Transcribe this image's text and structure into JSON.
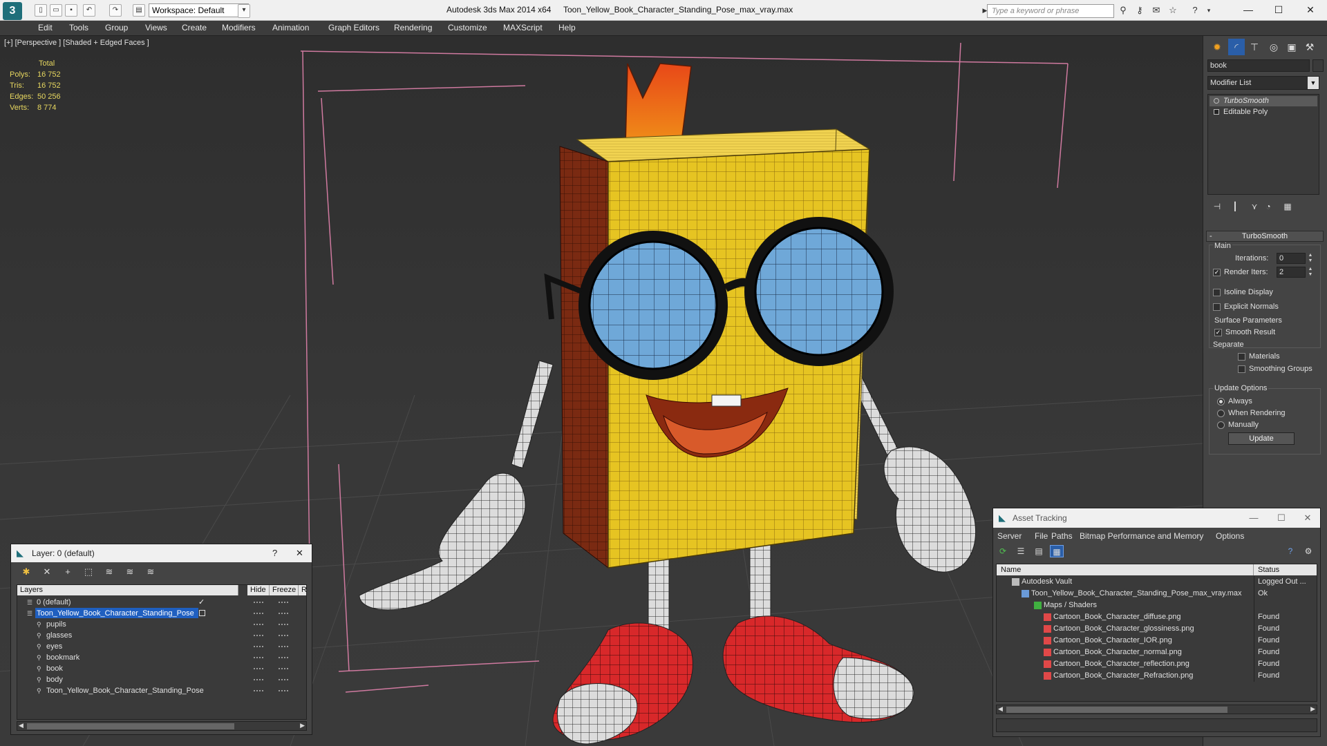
{
  "titlebar": {
    "workspace": "Workspace: Default",
    "app": "Autodesk 3ds Max  2014 x64",
    "file": "Toon_Yellow_Book_Character_Standing_Pose_max_vray.max",
    "search_placeholder": "Type a keyword or phrase"
  },
  "menu": [
    "Edit",
    "Tools",
    "Group",
    "Views",
    "Create",
    "Modifiers",
    "Animation",
    "Graph Editors",
    "Rendering",
    "Customize",
    "MAXScript",
    "Help"
  ],
  "viewport": {
    "label": "[+] [Perspective ] [Shaded + Edged Faces ]",
    "stats": {
      "header": "Total",
      "rows": [
        {
          "label": "Polys:",
          "value": "16 752"
        },
        {
          "label": "Tris:",
          "value": "16 752"
        },
        {
          "label": "Edges:",
          "value": "50 256"
        },
        {
          "label": "Verts:",
          "value": "8 774"
        }
      ]
    }
  },
  "command_panel": {
    "object_name": "book",
    "modifier_list": "Modifier List",
    "stack": [
      "TurboSmooth",
      "Editable Poly"
    ],
    "rollout": "TurboSmooth",
    "main_label": "Main",
    "iterations_label": "Iterations:",
    "iterations_value": "0",
    "render_iters_label": "Render Iters:",
    "render_iters_value": "2",
    "isoline": "Isoline Display",
    "explicit_normals": "Explicit Normals",
    "surface_params": "Surface Parameters",
    "smooth_result": "Smooth Result",
    "separate": "Separate",
    "materials": "Materials",
    "smoothing_groups": "Smoothing Groups",
    "update_options": "Update Options",
    "always": "Always",
    "when_rendering": "When Rendering",
    "manually": "Manually",
    "update_button": "Update"
  },
  "layer_dialog": {
    "title": "Layer: 0 (default)",
    "help": "?",
    "columns": [
      "Layers",
      "Hide",
      "Freeze",
      "R"
    ],
    "rows": [
      {
        "name": "0 (default)",
        "level": 0,
        "selected": false,
        "check": "✓"
      },
      {
        "name": "Toon_Yellow_Book_Character_Standing_Pose",
        "level": 0,
        "selected": true,
        "check": ""
      },
      {
        "name": "pupils",
        "level": 1,
        "selected": false,
        "check": ""
      },
      {
        "name": "glasses",
        "level": 1,
        "selected": false,
        "check": ""
      },
      {
        "name": "eyes",
        "level": 1,
        "selected": false,
        "check": ""
      },
      {
        "name": "bookmark",
        "level": 1,
        "selected": false,
        "check": ""
      },
      {
        "name": "book",
        "level": 1,
        "selected": false,
        "check": ""
      },
      {
        "name": "body",
        "level": 1,
        "selected": false,
        "check": ""
      },
      {
        "name": "Toon_Yellow_Book_Character_Standing_Pose",
        "level": 1,
        "selected": false,
        "check": ""
      }
    ]
  },
  "asset_dialog": {
    "title": "Asset Tracking",
    "menu": [
      "Server",
      "File",
      "Paths",
      "Bitmap Performance and Memory",
      "Options"
    ],
    "columns": [
      "Name",
      "Status"
    ],
    "rows": [
      {
        "name": "Autodesk Vault",
        "status": "Logged Out ...",
        "level": 0,
        "icon": "vault-icon"
      },
      {
        "name": "Toon_Yellow_Book_Character_Standing_Pose_max_vray.max",
        "status": "Ok",
        "level": 1,
        "icon": "max-file-icon"
      },
      {
        "name": "Maps / Shaders",
        "status": "",
        "level": 2,
        "icon": "maps-icon"
      },
      {
        "name": "Cartoon_Book_Character_diffuse.png",
        "status": "Found",
        "level": 3,
        "icon": "png-icon"
      },
      {
        "name": "Cartoon_Book_Character_glossiness.png",
        "status": "Found",
        "level": 3,
        "icon": "png-icon"
      },
      {
        "name": "Cartoon_Book_Character_IOR.png",
        "status": "Found",
        "level": 3,
        "icon": "png-icon"
      },
      {
        "name": "Cartoon_Book_Character_normal.png",
        "status": "Found",
        "level": 3,
        "icon": "png-icon"
      },
      {
        "name": "Cartoon_Book_Character_reflection.png",
        "status": "Found",
        "level": 3,
        "icon": "png-icon"
      },
      {
        "name": "Cartoon_Book_Character_Refraction.png",
        "status": "Found",
        "level": 3,
        "icon": "png-icon"
      }
    ]
  },
  "colors": {
    "stats_text": "#e8d860",
    "selection": "#1f5fc0",
    "book_yellow": "#e8c020",
    "spine": "#7a2a12",
    "lens": "#6fa8d8",
    "shoe_red": "#d8282a"
  }
}
